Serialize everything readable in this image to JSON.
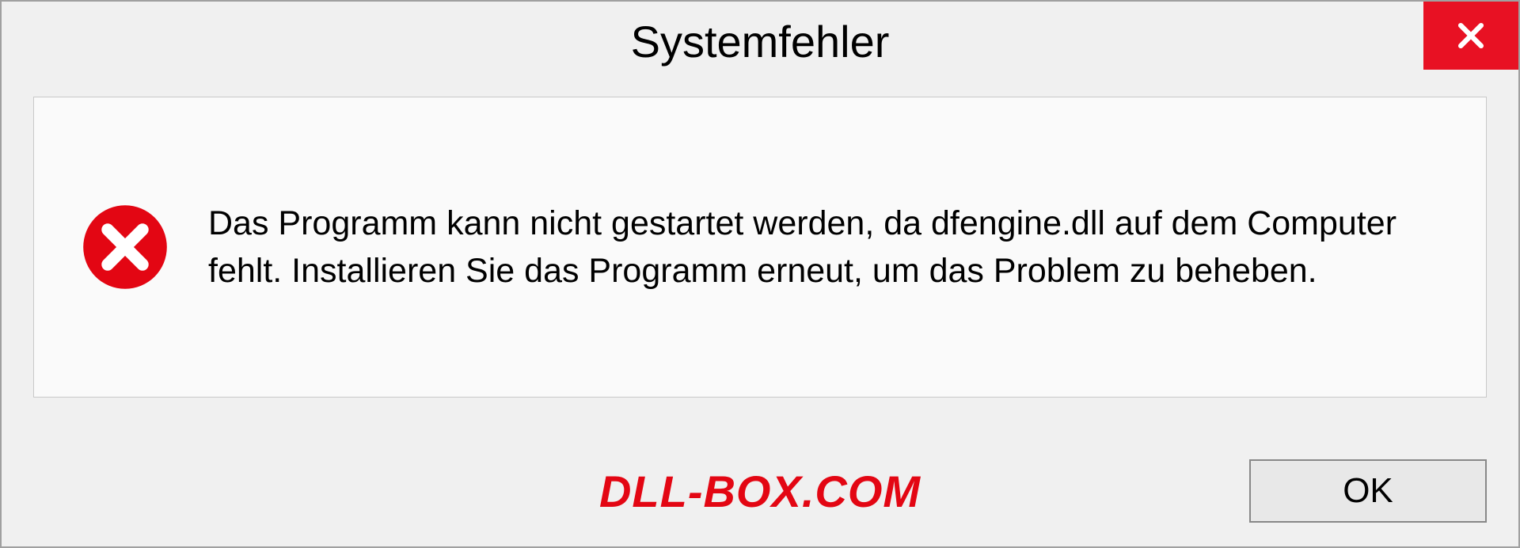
{
  "dialog": {
    "title": "Systemfehler",
    "message": "Das Programm kann nicht gestartet werden, da dfengine.dll auf dem Computer fehlt. Installieren Sie das Programm erneut, um das Problem zu beheben.",
    "ok_label": "OK"
  },
  "watermark": "DLL-BOX.COM"
}
